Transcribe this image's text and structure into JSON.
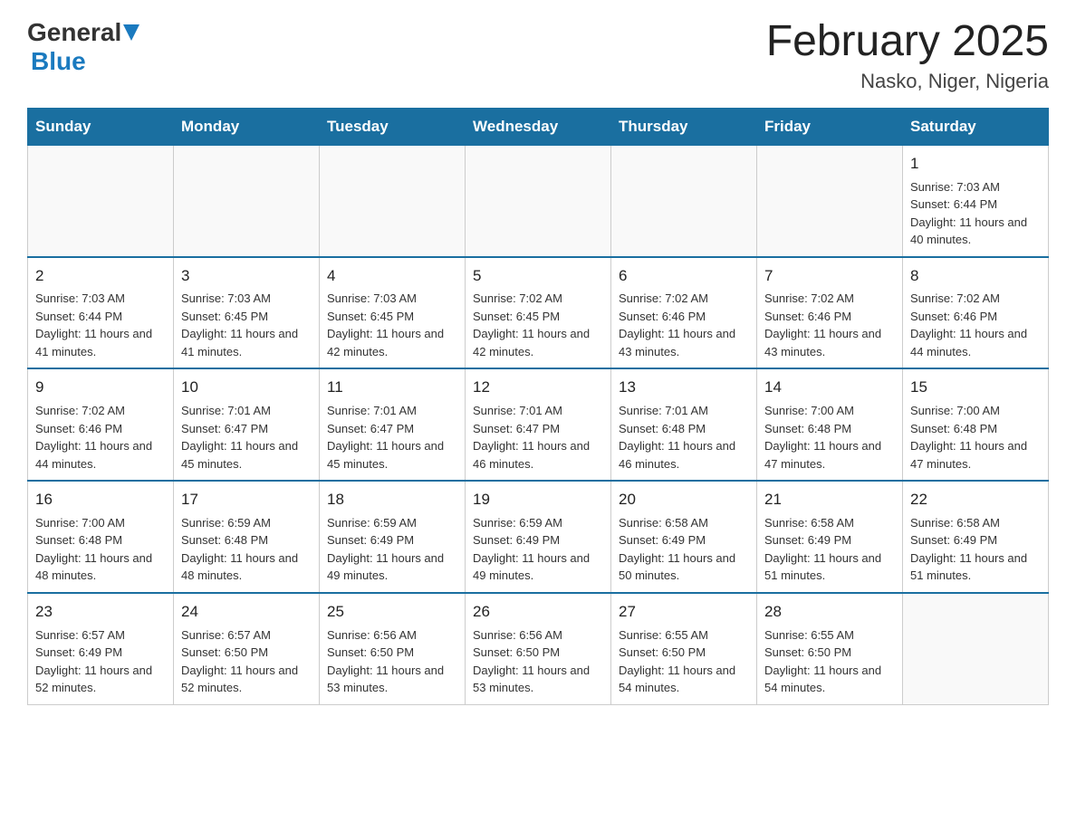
{
  "header": {
    "logo_general": "General",
    "logo_blue": "Blue",
    "month_title": "February 2025",
    "location": "Nasko, Niger, Nigeria"
  },
  "days_of_week": [
    "Sunday",
    "Monday",
    "Tuesday",
    "Wednesday",
    "Thursday",
    "Friday",
    "Saturday"
  ],
  "weeks": [
    [
      {
        "day": "",
        "info": ""
      },
      {
        "day": "",
        "info": ""
      },
      {
        "day": "",
        "info": ""
      },
      {
        "day": "",
        "info": ""
      },
      {
        "day": "",
        "info": ""
      },
      {
        "day": "",
        "info": ""
      },
      {
        "day": "1",
        "info": "Sunrise: 7:03 AM\nSunset: 6:44 PM\nDaylight: 11 hours and 40 minutes."
      }
    ],
    [
      {
        "day": "2",
        "info": "Sunrise: 7:03 AM\nSunset: 6:44 PM\nDaylight: 11 hours and 41 minutes."
      },
      {
        "day": "3",
        "info": "Sunrise: 7:03 AM\nSunset: 6:45 PM\nDaylight: 11 hours and 41 minutes."
      },
      {
        "day": "4",
        "info": "Sunrise: 7:03 AM\nSunset: 6:45 PM\nDaylight: 11 hours and 42 minutes."
      },
      {
        "day": "5",
        "info": "Sunrise: 7:02 AM\nSunset: 6:45 PM\nDaylight: 11 hours and 42 minutes."
      },
      {
        "day": "6",
        "info": "Sunrise: 7:02 AM\nSunset: 6:46 PM\nDaylight: 11 hours and 43 minutes."
      },
      {
        "day": "7",
        "info": "Sunrise: 7:02 AM\nSunset: 6:46 PM\nDaylight: 11 hours and 43 minutes."
      },
      {
        "day": "8",
        "info": "Sunrise: 7:02 AM\nSunset: 6:46 PM\nDaylight: 11 hours and 44 minutes."
      }
    ],
    [
      {
        "day": "9",
        "info": "Sunrise: 7:02 AM\nSunset: 6:46 PM\nDaylight: 11 hours and 44 minutes."
      },
      {
        "day": "10",
        "info": "Sunrise: 7:01 AM\nSunset: 6:47 PM\nDaylight: 11 hours and 45 minutes."
      },
      {
        "day": "11",
        "info": "Sunrise: 7:01 AM\nSunset: 6:47 PM\nDaylight: 11 hours and 45 minutes."
      },
      {
        "day": "12",
        "info": "Sunrise: 7:01 AM\nSunset: 6:47 PM\nDaylight: 11 hours and 46 minutes."
      },
      {
        "day": "13",
        "info": "Sunrise: 7:01 AM\nSunset: 6:48 PM\nDaylight: 11 hours and 46 minutes."
      },
      {
        "day": "14",
        "info": "Sunrise: 7:00 AM\nSunset: 6:48 PM\nDaylight: 11 hours and 47 minutes."
      },
      {
        "day": "15",
        "info": "Sunrise: 7:00 AM\nSunset: 6:48 PM\nDaylight: 11 hours and 47 minutes."
      }
    ],
    [
      {
        "day": "16",
        "info": "Sunrise: 7:00 AM\nSunset: 6:48 PM\nDaylight: 11 hours and 48 minutes."
      },
      {
        "day": "17",
        "info": "Sunrise: 6:59 AM\nSunset: 6:48 PM\nDaylight: 11 hours and 48 minutes."
      },
      {
        "day": "18",
        "info": "Sunrise: 6:59 AM\nSunset: 6:49 PM\nDaylight: 11 hours and 49 minutes."
      },
      {
        "day": "19",
        "info": "Sunrise: 6:59 AM\nSunset: 6:49 PM\nDaylight: 11 hours and 49 minutes."
      },
      {
        "day": "20",
        "info": "Sunrise: 6:58 AM\nSunset: 6:49 PM\nDaylight: 11 hours and 50 minutes."
      },
      {
        "day": "21",
        "info": "Sunrise: 6:58 AM\nSunset: 6:49 PM\nDaylight: 11 hours and 51 minutes."
      },
      {
        "day": "22",
        "info": "Sunrise: 6:58 AM\nSunset: 6:49 PM\nDaylight: 11 hours and 51 minutes."
      }
    ],
    [
      {
        "day": "23",
        "info": "Sunrise: 6:57 AM\nSunset: 6:49 PM\nDaylight: 11 hours and 52 minutes."
      },
      {
        "day": "24",
        "info": "Sunrise: 6:57 AM\nSunset: 6:50 PM\nDaylight: 11 hours and 52 minutes."
      },
      {
        "day": "25",
        "info": "Sunrise: 6:56 AM\nSunset: 6:50 PM\nDaylight: 11 hours and 53 minutes."
      },
      {
        "day": "26",
        "info": "Sunrise: 6:56 AM\nSunset: 6:50 PM\nDaylight: 11 hours and 53 minutes."
      },
      {
        "day": "27",
        "info": "Sunrise: 6:55 AM\nSunset: 6:50 PM\nDaylight: 11 hours and 54 minutes."
      },
      {
        "day": "28",
        "info": "Sunrise: 6:55 AM\nSunset: 6:50 PM\nDaylight: 11 hours and 54 minutes."
      },
      {
        "day": "",
        "info": ""
      }
    ]
  ]
}
